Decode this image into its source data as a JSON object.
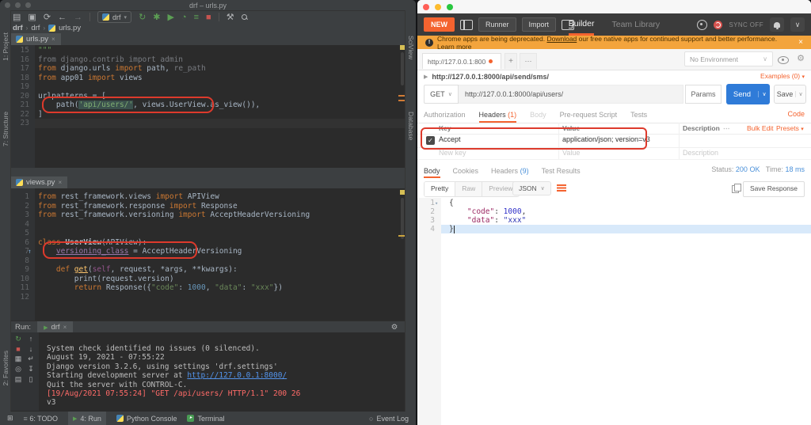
{
  "colors": {
    "postman_accent": "#f4632f",
    "send_button_blue": "#2f7bd8",
    "status_value_blue": "#4a90d9",
    "annotation_red": "#dd3a2c",
    "banner_orange": "#f3a43c"
  },
  "pycharm": {
    "title": "drf – urls.py",
    "toolbar": {
      "run_config": "drf"
    },
    "breadcrumb": {
      "a": "drf",
      "b": "drf",
      "c": "urls.py"
    },
    "left_stripe": {
      "project": "1: Project",
      "structure": "7: Structure",
      "favorites": "2: Favorites"
    },
    "right_stripe": {
      "sciview": "SciView",
      "database": "Database"
    },
    "tabs": {
      "urls": "urls.py",
      "views": "views.py"
    },
    "editors": [
      {
        "lines": [
          {
            "n": 15,
            "s": [
              {
                "t": "\"\"\"",
                "c": "doc"
              }
            ]
          },
          {
            "n": 16,
            "s": [
              {
                "t": "from django.contrib import admin",
                "c": "gr"
              }
            ]
          },
          {
            "n": 17,
            "s": [
              {
                "t": "from ",
                "c": "kw"
              },
              {
                "t": "django.urls ",
                "c": "pl"
              },
              {
                "t": "import ",
                "c": "kw"
              },
              {
                "t": "path",
                "c": "pl"
              },
              {
                "t": ", ",
                "c": "pl"
              },
              {
                "t": "re_path",
                "c": "gr"
              }
            ]
          },
          {
            "n": 18,
            "s": [
              {
                "t": "from ",
                "c": "kw"
              },
              {
                "t": "app01 ",
                "c": "pl"
              },
              {
                "t": "import ",
                "c": "kw"
              },
              {
                "t": "views",
                "c": "pl"
              }
            ]
          },
          {
            "n": 19,
            "s": []
          },
          {
            "n": 20,
            "s": [
              {
                "t": "urlpatterns = [",
                "c": "pl"
              }
            ]
          },
          {
            "n": 21,
            "s": [
              {
                "t": "    path(",
                "c": "pl"
              },
              {
                "t": "'api/users/'",
                "c": "sh"
              },
              {
                "t": ", views.UserView.as_view()),",
                "c": "pl"
              }
            ]
          },
          {
            "n": 22,
            "s": [
              {
                "t": "]",
                "c": "pl"
              }
            ]
          },
          {
            "n": 23,
            "hl": true,
            "s": []
          }
        ]
      },
      {
        "lines": [
          {
            "n": 1,
            "s": [
              {
                "t": "from ",
                "c": "kw"
              },
              {
                "t": "rest_framework.views ",
                "c": "pl"
              },
              {
                "t": "import ",
                "c": "kw"
              },
              {
                "t": "APIView",
                "c": "pl"
              }
            ]
          },
          {
            "n": 2,
            "s": [
              {
                "t": "from ",
                "c": "kw"
              },
              {
                "t": "rest_framework.response ",
                "c": "pl"
              },
              {
                "t": "import ",
                "c": "kw"
              },
              {
                "t": "Response",
                "c": "pl"
              }
            ]
          },
          {
            "n": 3,
            "s": [
              {
                "t": "from ",
                "c": "kw"
              },
              {
                "t": "rest_framework.versioning ",
                "c": "pl"
              },
              {
                "t": "import ",
                "c": "kw"
              },
              {
                "t": "AcceptHeaderVersioning",
                "c": "pl"
              }
            ]
          },
          {
            "n": 4,
            "s": []
          },
          {
            "n": 5,
            "s": []
          },
          {
            "n": 6,
            "s": [
              {
                "t": "class ",
                "c": "kw"
              },
              {
                "t": "UserView",
                "c": "cl"
              },
              {
                "t": "(APIView):",
                "c": "pl"
              }
            ]
          },
          {
            "n": 7,
            "g": "↑",
            "s": [
              {
                "t": "    ",
                "c": "pl"
              },
              {
                "t": "versioning_class",
                "c": "fld"
              },
              {
                "t": " = AcceptHeaderVersioning",
                "c": "pl"
              }
            ]
          },
          {
            "n": 8,
            "s": []
          },
          {
            "n": 9,
            "s": [
              {
                "t": "    ",
                "c": "pl"
              },
              {
                "t": "def ",
                "c": "kw"
              },
              {
                "t": "get",
                "c": "fn"
              },
              {
                "t": "(",
                "c": "pl"
              },
              {
                "t": "self",
                "c": "slf"
              },
              {
                "t": ", request, *args, **kwargs):",
                "c": "pl"
              }
            ]
          },
          {
            "n": 10,
            "s": [
              {
                "t": "        print(request.version)",
                "c": "pl"
              }
            ]
          },
          {
            "n": 11,
            "s": [
              {
                "t": "        ",
                "c": "pl"
              },
              {
                "t": "return ",
                "c": "kw"
              },
              {
                "t": "Response({",
                "c": "pl"
              },
              {
                "t": "\"code\"",
                "c": "str"
              },
              {
                "t": ": ",
                "c": "pl"
              },
              {
                "t": "1000",
                "c": "num"
              },
              {
                "t": ", ",
                "c": "pl"
              },
              {
                "t": "\"data\"",
                "c": "str"
              },
              {
                "t": ": ",
                "c": "pl"
              },
              {
                "t": "\"xxx\"",
                "c": "str"
              },
              {
                "t": "})",
                "c": "pl"
              }
            ]
          },
          {
            "n": 12,
            "s": []
          }
        ]
      }
    ],
    "run_panel": {
      "label": "Run:",
      "tab": "drf",
      "console": [
        {
          "s": [
            {
              "t": "System check identified no issues (0 silenced).",
              "c": "c"
            }
          ]
        },
        {
          "s": [
            {
              "t": "August 19, 2021 - 07:55:22",
              "c": "c"
            }
          ]
        },
        {
          "s": [
            {
              "t": "Django version 3.2.6, using settings 'drf.settings'",
              "c": "c"
            }
          ]
        },
        {
          "s": [
            {
              "t": "Starting development server at ",
              "c": "c"
            },
            {
              "t": "http://127.0.0.1:8000/",
              "c": "lk"
            }
          ]
        },
        {
          "s": [
            {
              "t": "Quit the server with CONTROL-C.",
              "c": "c"
            }
          ]
        },
        {
          "s": [
            {
              "t": "[19/Aug/2021 07:55:24] \"GET /api/users/ HTTP/1.1\" 200 26",
              "c": "r"
            }
          ]
        },
        {
          "s": [
            {
              "t": "v3",
              "c": "c"
            }
          ]
        }
      ]
    },
    "statusbar": {
      "todo": "6: TODO",
      "run": "4: Run",
      "python_console": "Python Console",
      "terminal": "Terminal",
      "event_log": "Event Log"
    }
  },
  "postman": {
    "topbar": {
      "new": "NEW",
      "runner": "Runner",
      "import_btn": "Import",
      "builder": "Builder",
      "team_library": "Team Library",
      "sync_off": "SYNC OFF"
    },
    "banner": {
      "lead": "Chrome apps are being deprecated.",
      "download": "Download",
      "rest": "our free native apps for continued support and better performance.",
      "learn_more": "Learn more",
      "close": "×"
    },
    "tabbar": {
      "tab": "http://127.0.0.1:800",
      "plus": "+",
      "more": "⋯",
      "environment": "No Environment"
    },
    "request": {
      "name": "http://127.0.0.1:8000/api/send/sms/",
      "examples": "Examples (0)",
      "method": "GET",
      "url": "http://127.0.0.1:8000/api/users/",
      "params": "Params",
      "send": "Send",
      "save": "Save"
    },
    "req_tabs": {
      "authorization": "Authorization",
      "headers": "Headers",
      "headers_count": "(1)",
      "body": "Body",
      "pre_request": "Pre-request Script",
      "tests": "Tests",
      "code": "Code"
    },
    "headers_table": {
      "col_key": "Key",
      "col_value": "Value",
      "col_desc": "Description",
      "more": "⋯",
      "bulk_edit": "Bulk Edit",
      "presets": "Presets",
      "row": {
        "key": "Accept",
        "value": "application/json; version=v3",
        "check": "✓"
      },
      "placeholder_key": "New key",
      "placeholder_value": "Value",
      "placeholder_desc": "Description"
    },
    "response": {
      "body": "Body",
      "cookies": "Cookies",
      "headers": "Headers",
      "headers_count": "(9)",
      "test_results": "Test Results",
      "status_label": "Status:",
      "status_value": "200 OK",
      "time_label": "Time:",
      "time_value": "18 ms",
      "pretty": "Pretty",
      "raw": "Raw",
      "preview": "Preview",
      "format": "JSON",
      "save_response": "Save Response",
      "json": [
        {
          "n": 1,
          "g": "▾",
          "s": [
            {
              "t": "{",
              "c": "p"
            }
          ]
        },
        {
          "n": 2,
          "s": [
            {
              "t": "    ",
              "c": "p"
            },
            {
              "t": "\"code\"",
              "c": "k"
            },
            {
              "t": ": ",
              "c": "p"
            },
            {
              "t": "1000",
              "c": "nm"
            },
            {
              "t": ",",
              "c": "p"
            }
          ]
        },
        {
          "n": 3,
          "s": [
            {
              "t": "    ",
              "c": "p"
            },
            {
              "t": "\"data\"",
              "c": "k"
            },
            {
              "t": ": ",
              "c": "p"
            },
            {
              "t": "\"xxx\"",
              "c": "st"
            }
          ]
        },
        {
          "n": 4,
          "hl": true,
          "s": [
            {
              "t": "}",
              "c": "p"
            },
            {
              "t": "",
              "c": "cur"
            }
          ]
        }
      ]
    }
  }
}
